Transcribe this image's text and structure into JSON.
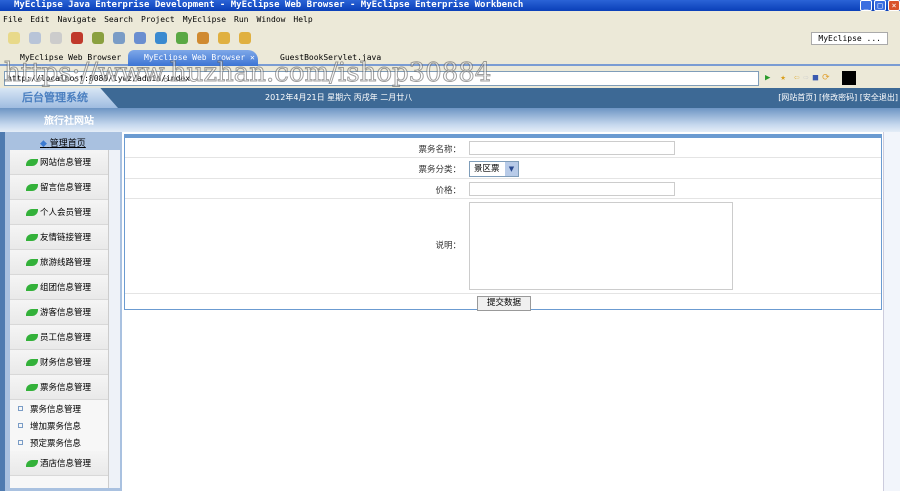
{
  "window": {
    "title": "MyEclipse Java Enterprise Development - MyEclipse Web Browser - MyEclipse Enterprise Workbench"
  },
  "menu": [
    "File",
    "Edit",
    "Navigate",
    "Search",
    "Project",
    "MyEclipse",
    "Run",
    "Window",
    "Help"
  ],
  "perspective": "MyEclipse ...",
  "tabs": [
    {
      "label": "MyEclipse Web Browser"
    },
    {
      "label": "MyEclipse Web Browser",
      "active": true
    },
    {
      "label": "GuestBookServlet.java"
    }
  ],
  "address": "http://localhost:8080/lywz/admin/index",
  "watermark": "https://www.huzhan.com/ishop30884",
  "header": {
    "logo": "后台管理系统",
    "date": "2012年4月21日 星期六 丙戌年 二月廿八",
    "links": "[网站首页] [修改密码] [安全退出]",
    "site_name": "旅行社网站"
  },
  "sidebar": {
    "home": "管理首页",
    "items": [
      "网站信息管理",
      "留言信息管理",
      "个人会员管理",
      "友情链接管理",
      "旅游线路管理",
      "组团信息管理",
      "游客信息管理",
      "员工信息管理",
      "财务信息管理",
      "票务信息管理"
    ],
    "subitems": [
      "票务信息管理",
      "增加票务信息",
      "预定票务信息"
    ],
    "after": "酒店信息管理"
  },
  "form": {
    "name_label": "票务名称：",
    "name_value": "",
    "category_label": "票务分类：",
    "category_value": "景区票",
    "price_label": "价格：",
    "price_value": "",
    "desc_label": "说明：",
    "desc_value": "",
    "submit": "提交数据"
  }
}
